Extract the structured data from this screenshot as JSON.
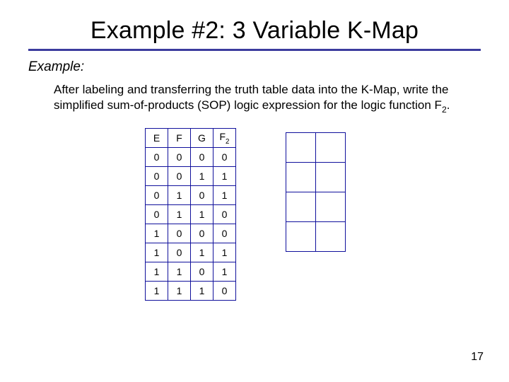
{
  "title": "Example #2: 3 Variable K-Map",
  "example_label": "Example:",
  "description_before": "After labeling and transferring the truth table data into the K-Map, write the simplified sum-of-products (SOP) logic expression for the logic function F",
  "description_sub": "2",
  "description_after": ".",
  "truth_table": {
    "headers": [
      "E",
      "F",
      "G"
    ],
    "output_header_base": "F",
    "output_header_sub": "2",
    "rows": [
      [
        "0",
        "0",
        "0",
        "0"
      ],
      [
        "0",
        "0",
        "1",
        "1"
      ],
      [
        "0",
        "1",
        "0",
        "1"
      ],
      [
        "0",
        "1",
        "1",
        "0"
      ],
      [
        "1",
        "0",
        "0",
        "0"
      ],
      [
        "1",
        "0",
        "1",
        "1"
      ],
      [
        "1",
        "1",
        "0",
        "1"
      ],
      [
        "1",
        "1",
        "1",
        "0"
      ]
    ]
  },
  "kmap": {
    "rows": 4,
    "cols": 2
  },
  "page_number": "17"
}
